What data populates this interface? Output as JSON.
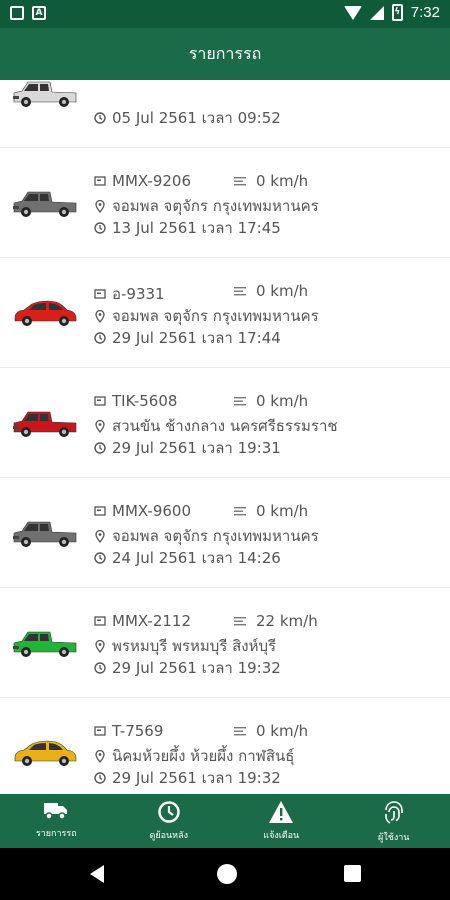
{
  "status_bar": {
    "time": "7:32",
    "battery_level": "battery-charging",
    "colors": {
      "bar": "#0f5a39"
    }
  },
  "app_bar": {
    "title": "รายการรถ",
    "color": "#1b6b48"
  },
  "vehicles": [
    {
      "plate": "",
      "speed": "",
      "location": "",
      "datetime": "05 Jul 2561  เวลา 09:52",
      "car_color": "#d9d9d9",
      "car_type": "pickup"
    },
    {
      "plate": "MMX-9206",
      "speed": "0 km/h",
      "location": "จอมพล จตุจักร กรุงเทพมหานคร",
      "datetime": "13 Jul 2561  เวลา 17:45",
      "car_color": "#707070",
      "car_type": "pickup"
    },
    {
      "plate": "อ-9331",
      "speed": "0 km/h",
      "location": "จอมพล จตุจักร กรุงเทพมหานคร",
      "datetime": "29 Jul 2561  เวลา 17:44",
      "car_color": "#d8201a",
      "car_type": "sedan"
    },
    {
      "plate": "TIK-5608",
      "speed": "0 km/h",
      "location": "สวนขัน ช้างกลาง นครศรีธรรมราช",
      "datetime": "29 Jul 2561  เวลา 19:31",
      "car_color": "#c8161c",
      "car_type": "pickup"
    },
    {
      "plate": "MMX-9600",
      "speed": "0 km/h",
      "location": "จอมพล จตุจักร กรุงเทพมหานคร",
      "datetime": "24 Jul 2561  เวลา 14:26",
      "car_color": "#707070",
      "car_type": "pickup"
    },
    {
      "plate": "MMX-2112",
      "speed": "22 km/h",
      "location": "พรหมบุรี พรหมบุรี สิงห์บุรี",
      "datetime": "29 Jul 2561  เวลา 19:32",
      "car_color": "#22b439",
      "car_type": "pickup"
    },
    {
      "plate": "T-7569",
      "speed": "0 km/h",
      "location": "นิคมห้วยผึ้ง ห้วยผึ้ง กาฬสินธุ์",
      "datetime": "29 Jul 2561  เวลา 19:32",
      "car_color": "#e8b11a",
      "car_type": "sedan"
    }
  ],
  "bottom_nav": {
    "items": [
      {
        "label": "รายการรถ",
        "icon": "truck-icon"
      },
      {
        "label": "ดูย้อนหลัง",
        "icon": "clock-icon"
      },
      {
        "label": "แจ้งเตือน",
        "icon": "warning-icon"
      },
      {
        "label": "ผู้ใช้งาน",
        "icon": "fingerprint-icon"
      }
    ]
  }
}
